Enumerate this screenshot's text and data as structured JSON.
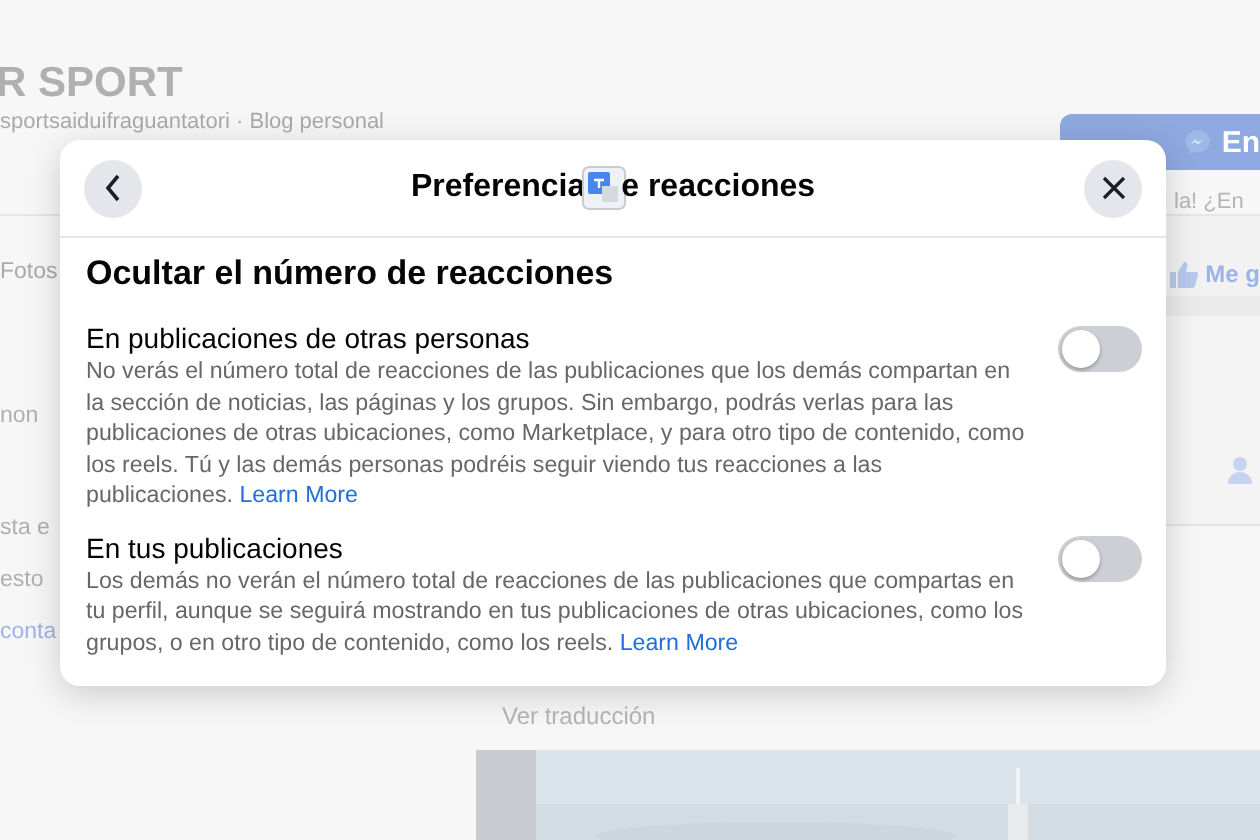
{
  "page": {
    "name": "R SPORT",
    "subtitle": "sportsaiduifraguantatori · Blog personal",
    "message_button": "En",
    "greeting": "la! ¿En",
    "tab": "Fotos",
    "like_button": "Me g",
    "left_snippets": [
      "non",
      "sta e",
      "esto"
    ],
    "left_link": "conta",
    "translation_link": "Ver traducción"
  },
  "dialog": {
    "title_before": "Preferencia",
    "title_after": "e reacciones",
    "heading": "Ocultar el número de reacciones",
    "settings": [
      {
        "title": "En publicaciones de otras personas",
        "description": "No verás el número total de reacciones de las publicaciones que los demás compartan en la sección de noticias, las páginas y los grupos. Sin embargo, podrás verlas para las publicaciones de otras ubicaciones, como Marketplace, y para otro tipo de contenido, como los reels. Tú y las demás personas podréis seguir viendo tus reacciones a las publicaciones.",
        "link": "Learn More",
        "on": false
      },
      {
        "title": "En tus publicaciones",
        "description": "Los demás no verán el número total de reacciones de las publicaciones que compartas en tu perfil, aunque se seguirá mostrando en tus publicaciones de otras ubicaciones, como los grupos, o en otro tipo de contenido, como los reels.",
        "link": "Learn More",
        "on": false
      }
    ]
  }
}
